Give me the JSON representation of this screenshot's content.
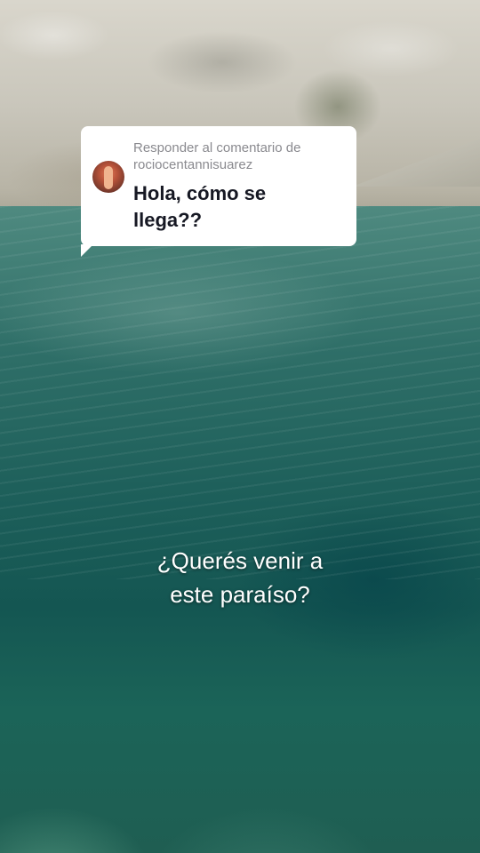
{
  "reply_comment": {
    "prefix": "Responder al comentario de",
    "username": "rociocentannisuarez",
    "text": "Hola, cómo se llega??"
  },
  "caption": {
    "line1": "¿Querés venir a",
    "line2": "este paraíso?"
  },
  "colors": {
    "bubble_background": "#ffffff",
    "secondary_text": "#8a8a8f",
    "primary_text": "#161823",
    "caption_text": "#ffffff"
  },
  "icons": {
    "avatar": "user-avatar-photo"
  }
}
